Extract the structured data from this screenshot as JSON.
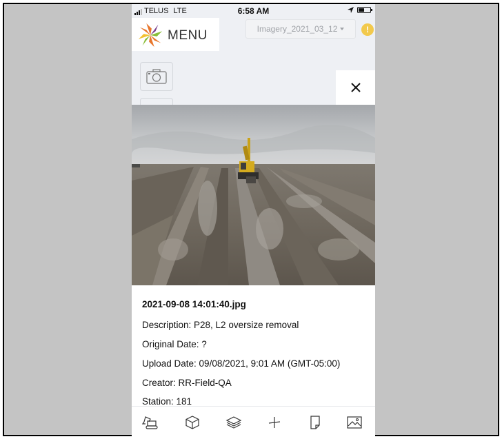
{
  "status_bar": {
    "carrier": "TELUS",
    "network": "LTE",
    "time": "6:58 AM"
  },
  "header": {
    "menu_label": "MENU",
    "imagery_select": "Imagery_2021_03_12",
    "alert_symbol": "!"
  },
  "controls": {
    "camera_icon": "camera-icon",
    "close_icon": "close-icon"
  },
  "photo": {
    "subject": "excavator-on-graded-field"
  },
  "details": {
    "filename": "2021-09-08 14:01:40.jpg",
    "description": "Description: P28, L2 oversize removal",
    "original_date": "Original Date: ?",
    "upload_date": "Upload Date: 09/08/2021, 9:01 AM (GMT-05:00)",
    "creator": "Creator: RR-Field-QA",
    "station": "Station: 181"
  },
  "toolbar": {
    "items": [
      {
        "icon": "excavator-icon"
      },
      {
        "icon": "box-3d-icon"
      },
      {
        "icon": "layers-icon"
      },
      {
        "icon": "crosshair-icon"
      },
      {
        "icon": "document-icon"
      },
      {
        "icon": "image-icon"
      }
    ]
  },
  "colors": {
    "frame_background": "#c4c4c4",
    "app_background": "#eef0f4",
    "alert": "#f2c94c",
    "logo_orange": "#e8762b",
    "logo_green": "#8bbf3c",
    "logo_purple": "#7a3e8c",
    "logo_yellow": "#f2c232"
  }
}
